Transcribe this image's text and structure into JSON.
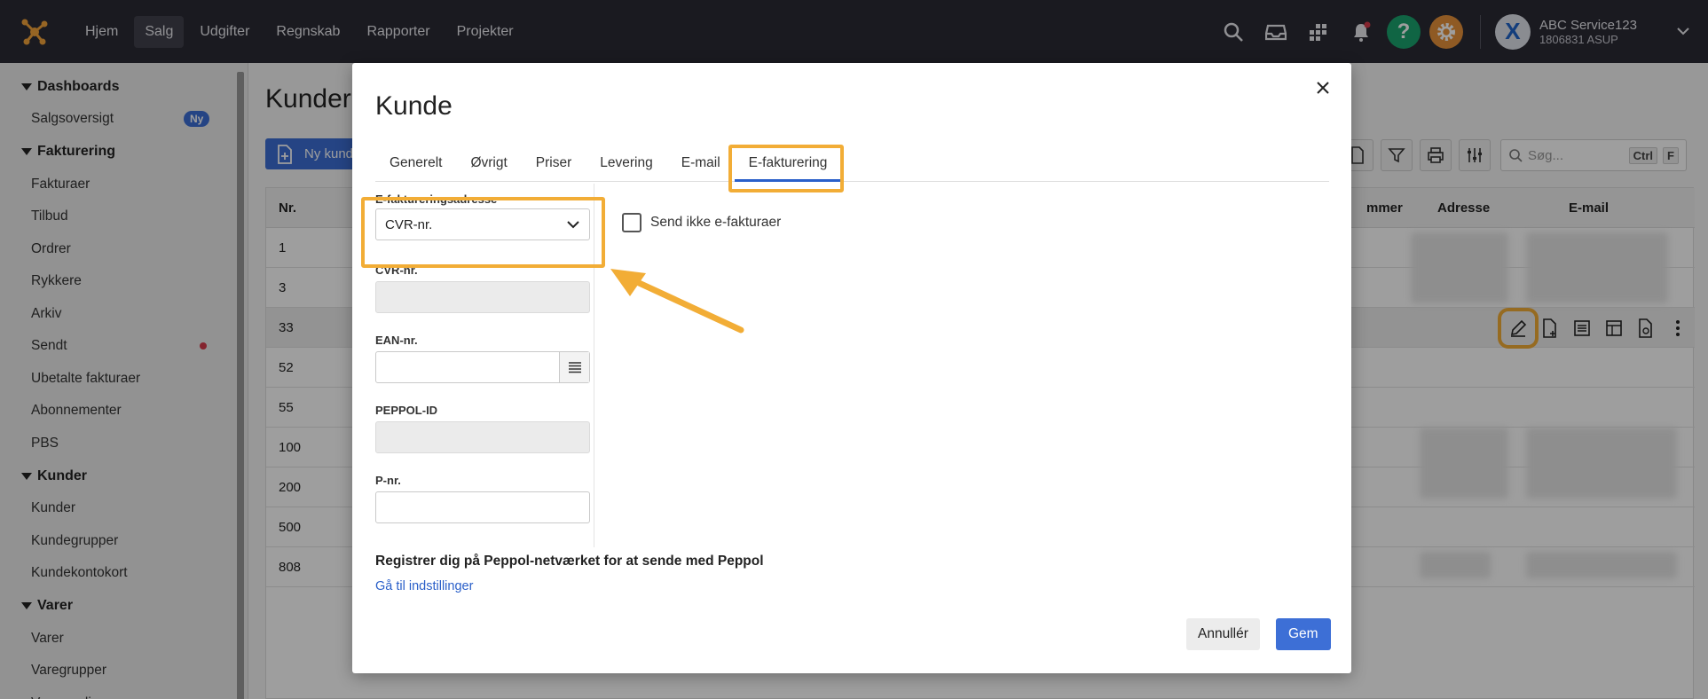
{
  "topnav": {
    "items": [
      {
        "label": "Hjem",
        "active": false
      },
      {
        "label": "Salg",
        "active": true
      },
      {
        "label": "Udgifter",
        "active": false
      },
      {
        "label": "Regnskab",
        "active": false
      },
      {
        "label": "Rapporter",
        "active": false
      },
      {
        "label": "Projekter",
        "active": false
      }
    ],
    "user": {
      "name": "ABC Service123",
      "sub": "1806831 ASUP",
      "avatar_letter": "X"
    }
  },
  "sidebar": {
    "sections": [
      {
        "label": "Dashboards",
        "items": [
          {
            "label": "Salgsoversigt",
            "badge": "Ny"
          }
        ]
      },
      {
        "label": "Fakturering",
        "items": [
          {
            "label": "Fakturaer"
          },
          {
            "label": "Tilbud"
          },
          {
            "label": "Ordrer"
          },
          {
            "label": "Rykkere"
          },
          {
            "label": "Arkiv"
          },
          {
            "label": "Sendt"
          },
          {
            "label": "Ubetalte fakturaer"
          },
          {
            "label": "Abonnementer"
          },
          {
            "label": "PBS"
          }
        ]
      },
      {
        "label": "Kunder",
        "items": [
          {
            "label": "Kunder"
          },
          {
            "label": "Kundegrupper"
          },
          {
            "label": "Kundekontokort"
          }
        ]
      },
      {
        "label": "Varer",
        "items": [
          {
            "label": "Varer"
          },
          {
            "label": "Varegrupper"
          },
          {
            "label": "Varesamlinger"
          }
        ]
      }
    ]
  },
  "main": {
    "title": "Kunder",
    "new_button": "Ny kunde",
    "search_placeholder": "Søg...",
    "kbd1": "Ctrl",
    "kbd2": "F",
    "columns": {
      "nr": "Nr.",
      "nummer": "mmer",
      "adresse": "Adresse",
      "email": "E-mail"
    },
    "rows": [
      "1",
      "3",
      "33",
      "52",
      "55",
      "100",
      "200",
      "500",
      "808"
    ]
  },
  "modal": {
    "title": "Kunde",
    "tabs": [
      "Generelt",
      "Øvrigt",
      "Priser",
      "Levering",
      "E-mail",
      "E-fakturering"
    ],
    "active_tab": "E-fakturering",
    "fields": {
      "address_label": "E-faktureringsadresse",
      "address_value": "CVR-nr.",
      "cvr_label": "CVR-nr.",
      "ean_label": "EAN-nr.",
      "peppol_label": "PEPPOL-ID",
      "pnr_label": "P-nr."
    },
    "checkbox_label": "Send ikke e-fakturaer",
    "peppol_text": "Registrer dig på Peppol-netværket for at sende med Peppol",
    "peppol_link": "Gå til indstillinger",
    "cancel": "Annullér",
    "save": "Gem"
  },
  "colors": {
    "highlight": "#f2ad36",
    "primary": "#3d6fd6",
    "topbar": "#2b2b35"
  }
}
